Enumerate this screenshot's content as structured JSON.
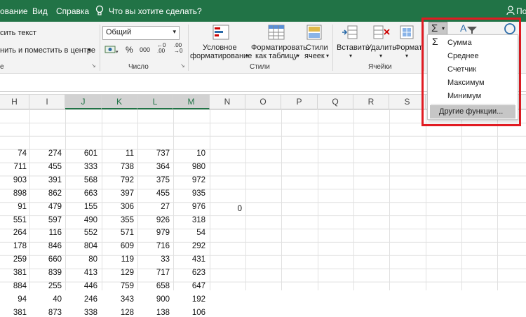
{
  "menubar": {
    "tabs": [
      "ование",
      "Вид",
      "Справка"
    ],
    "tell_me": "Что вы хотите сделать?",
    "share": "По"
  },
  "ribbon": {
    "wrap_text": "сить текст",
    "merge_center": "нить и поместить в центре",
    "left_group_label": "е",
    "number_format": "Общий",
    "number_group_label": "Число",
    "conditional_formatting": [
      "Условное",
      "форматирование"
    ],
    "format_as_table": [
      "Форматировать",
      "как таблицу"
    ],
    "cell_styles": [
      "Стили",
      "ячеек"
    ],
    "styles_group_label": "Стили",
    "insert": "Вставить",
    "delete": "Удалить",
    "format": "Формат",
    "cells_group_label": "Ячейки",
    "sort_filter_letter": "A"
  },
  "columns": [
    "H",
    "I",
    "J",
    "K",
    "L",
    "M",
    "N",
    "O",
    "P",
    "Q",
    "R",
    "S"
  ],
  "selected_columns": [
    "J",
    "K",
    "L",
    "M"
  ],
  "rows": [
    [
      "74",
      "274",
      "601",
      "11",
      "737",
      "10"
    ],
    [
      "711",
      "455",
      "333",
      "738",
      "364",
      "980"
    ],
    [
      "903",
      "391",
      "568",
      "792",
      "375",
      "972"
    ],
    [
      "898",
      "862",
      "663",
      "397",
      "455",
      "935"
    ],
    [
      "91",
      "479",
      "155",
      "306",
      "27",
      "976"
    ],
    [
      "551",
      "597",
      "490",
      "355",
      "926",
      "318"
    ],
    [
      "264",
      "116",
      "552",
      "571",
      "979",
      "54"
    ],
    [
      "178",
      "846",
      "804",
      "609",
      "716",
      "292"
    ],
    [
      "259",
      "660",
      "80",
      "119",
      "33",
      "431"
    ],
    [
      "381",
      "839",
      "413",
      "129",
      "717",
      "623"
    ],
    [
      "884",
      "255",
      "446",
      "759",
      "658",
      "647"
    ],
    [
      "94",
      "40",
      "246",
      "343",
      "900",
      "192"
    ],
    [
      "381",
      "873",
      "338",
      "128",
      "138",
      "106"
    ]
  ],
  "extra_cell": "0",
  "autosum_menu": {
    "items": [
      "Сумма",
      "Среднее",
      "Счетчик",
      "Максимум",
      "Минимум"
    ],
    "more": "Другие функции..."
  },
  "colors": {
    "excel_green": "#217346",
    "highlight_red": "#e11b22"
  }
}
